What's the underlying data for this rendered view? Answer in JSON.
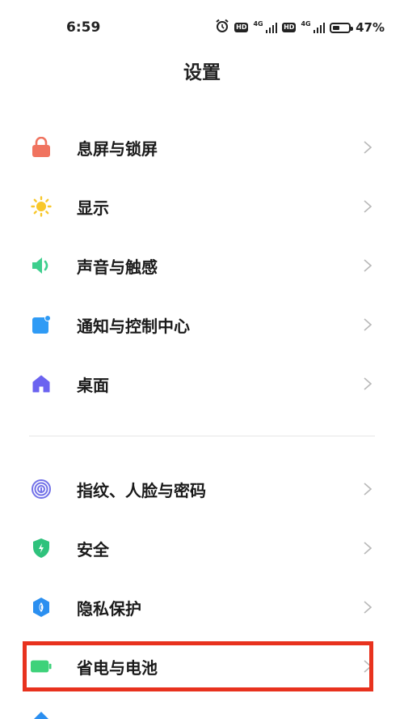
{
  "status_bar": {
    "time": "6:59",
    "hd": "HD",
    "network": "4G",
    "battery_pct": "47%",
    "battery_level": 0.47
  },
  "title": "设置",
  "groups": [
    {
      "items": [
        {
          "label": "息屏与锁屏",
          "icon": "lock-icon",
          "color": "#f0735f"
        },
        {
          "label": "显示",
          "icon": "sun-icon",
          "color": "#f8c72b"
        },
        {
          "label": "声音与触感",
          "icon": "speaker-icon",
          "color": "#3ecf8e"
        },
        {
          "label": "通知与控制中心",
          "icon": "notification-icon",
          "color": "#2f9bf5"
        },
        {
          "label": "桌面",
          "icon": "home-icon",
          "color": "#6b63f0"
        }
      ]
    },
    {
      "items": [
        {
          "label": "指纹、人脸与密码",
          "icon": "fingerprint-icon",
          "color": "#7271e8"
        },
        {
          "label": "安全",
          "icon": "shield-icon",
          "color": "#2fc27c"
        },
        {
          "label": "隐私保护",
          "icon": "privacy-icon",
          "color": "#2b8ff0"
        },
        {
          "label": "省电与电池",
          "icon": "battery-icon",
          "color": "#3ed27a"
        }
      ]
    }
  ],
  "highlight_color": "#e8321e"
}
